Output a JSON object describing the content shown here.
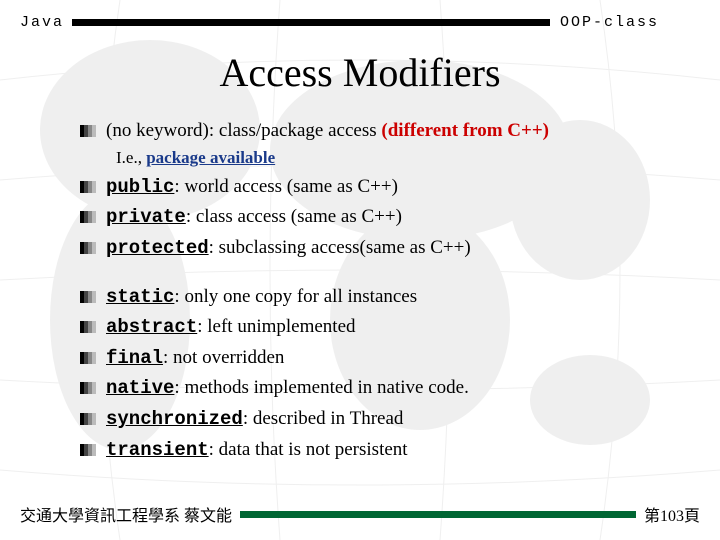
{
  "header": {
    "left": "Java",
    "right": "OOP-class"
  },
  "title": "Access Modifiers",
  "items": {
    "nokw": {
      "label_pre": "(no keyword): class/package access ",
      "label_em": "(different from C++)",
      "sub_pre": "I.e., ",
      "sub_em": "package available"
    },
    "public": {
      "kw": "public",
      "rest": ": world access (same as C++)"
    },
    "private": {
      "kw": "private",
      "rest": ": class access (same as C++)"
    },
    "protected": {
      "kw": "protected",
      "rest": ": subclassing access(same as C++)"
    },
    "static": {
      "kw": "static",
      "rest": ": only one copy for all instances"
    },
    "abstract": {
      "kw": "abstract",
      "rest": ": left unimplemented"
    },
    "final": {
      "kw": "final",
      "rest": ": not overridden"
    },
    "native": {
      "kw": "native",
      "rest": ": methods implemented in native code."
    },
    "synchronized": {
      "kw": "synchronized",
      "rest": ": described in Thread"
    },
    "transient": {
      "kw": "transient",
      "rest": ": data that is not persistent"
    }
  },
  "footer": {
    "left": "交通大學資訊工程學系 蔡文能",
    "right": "第103頁"
  }
}
